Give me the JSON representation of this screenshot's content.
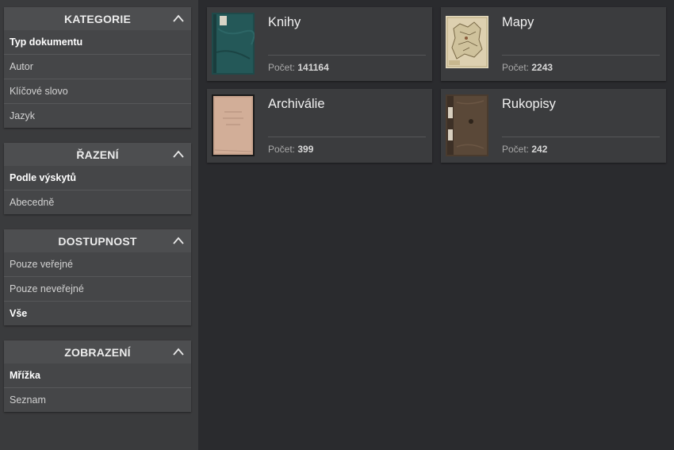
{
  "sidebar": {
    "panels": [
      {
        "title": "KATEGORIE",
        "items": [
          {
            "label": "Typ dokumentu",
            "selected": true
          },
          {
            "label": "Autor",
            "selected": false
          },
          {
            "label": "Klíčové slovo",
            "selected": false
          },
          {
            "label": "Jazyk",
            "selected": false
          }
        ]
      },
      {
        "title": "ŘAZENÍ",
        "items": [
          {
            "label": "Podle výskytů",
            "selected": true
          },
          {
            "label": "Abecedně",
            "selected": false
          }
        ]
      },
      {
        "title": "DOSTUPNOST",
        "items": [
          {
            "label": "Pouze veřejné",
            "selected": false
          },
          {
            "label": "Pouze neveřejné",
            "selected": false
          },
          {
            "label": "Vše",
            "selected": true
          }
        ]
      },
      {
        "title": "ZOBRAZENÍ",
        "items": [
          {
            "label": "Mřížka",
            "selected": true
          },
          {
            "label": "Seznam",
            "selected": false
          }
        ]
      }
    ]
  },
  "cards": [
    {
      "title": "Knihy",
      "count_label": "Počet:",
      "count": "141164",
      "thumb_icon": "book-cover-icon"
    },
    {
      "title": "Mapy",
      "count_label": "Počet:",
      "count": "2243",
      "thumb_icon": "map-icon"
    },
    {
      "title": "Archiválie",
      "count_label": "Počet:",
      "count": "399",
      "thumb_icon": "archive-document-icon"
    },
    {
      "title": "Rukopisy",
      "count_label": "Počet:",
      "count": "242",
      "thumb_icon": "manuscript-icon"
    }
  ],
  "colors": {
    "page_bg": "#2a2b2e",
    "sidebar_bg": "#3a3b3d",
    "panel_header_bg": "#4d4e50",
    "card_bg": "#3b3c3e"
  }
}
